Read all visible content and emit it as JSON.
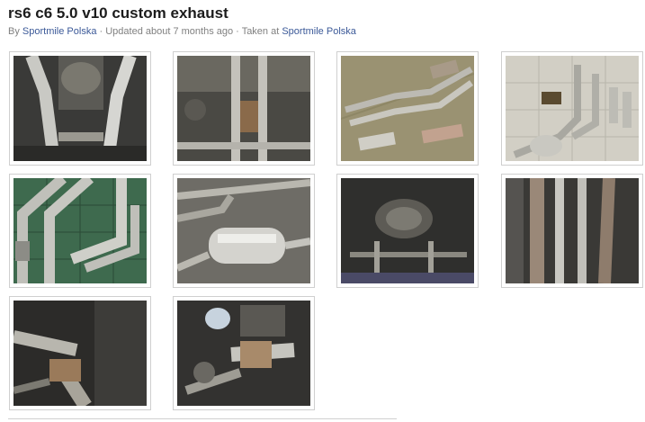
{
  "album": {
    "title": "rs6 c6 5.0 v10 custom exhaust",
    "by_prefix": "By",
    "author": "Sportmile Polska",
    "updated": "· Updated about 7 months ago · Taken at",
    "location": "Sportmile Polska"
  },
  "photos": [
    {
      "name": "photo-exhaust-underbody-1",
      "scene": "dark"
    },
    {
      "name": "photo-exhaust-underbody-2",
      "scene": "dark"
    },
    {
      "name": "photo-exhaust-floor-1",
      "scene": "floor"
    },
    {
      "name": "photo-exhaust-floor-2",
      "scene": "tiles"
    },
    {
      "name": "photo-exhaust-pipes-1",
      "scene": "tiles"
    },
    {
      "name": "photo-exhaust-muffler",
      "scene": "metal"
    },
    {
      "name": "photo-exhaust-underbody-3",
      "scene": "dark"
    },
    {
      "name": "photo-exhaust-underbody-4",
      "scene": "dark"
    },
    {
      "name": "photo-exhaust-downpipe",
      "scene": "dark"
    },
    {
      "name": "photo-exhaust-engine-bay",
      "scene": "dark"
    }
  ],
  "colors": {
    "link": "#3b5998",
    "title": "#1c1c1c",
    "meta": "#808080"
  }
}
